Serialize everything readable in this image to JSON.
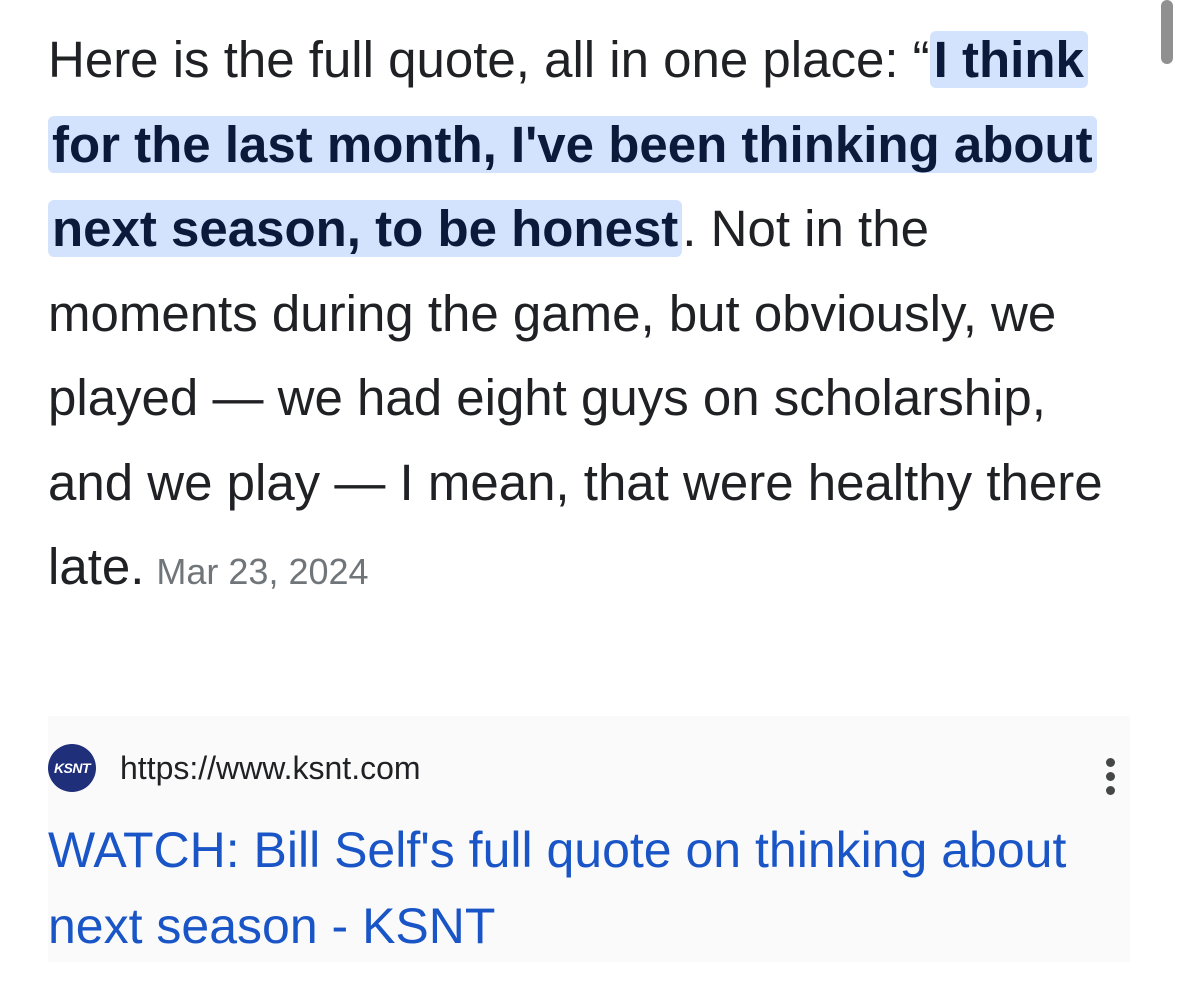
{
  "snippet": {
    "intro": "Here is the full quote, all in one place: “",
    "highlighted": "I think for the last month, I've been thinking about next season, to be honest",
    "rest": ". Not in the moments during the game, but obviously, we played — we had eight guys on scholarship, and we play — I mean, that were healthy there late.",
    "date": "Mar 23, 2024"
  },
  "result": {
    "favicon_text": "KSNT",
    "url": "https://www.ksnt.com",
    "title": "WATCH: Bill Self's full quote on thinking about next season - KSNT",
    "more_icon": "more-vert-icon"
  },
  "colors": {
    "highlight_bg": "#d3e3fd",
    "link": "#1a55c7",
    "favicon_bg": "#1f2f7a",
    "date": "#70757a"
  }
}
